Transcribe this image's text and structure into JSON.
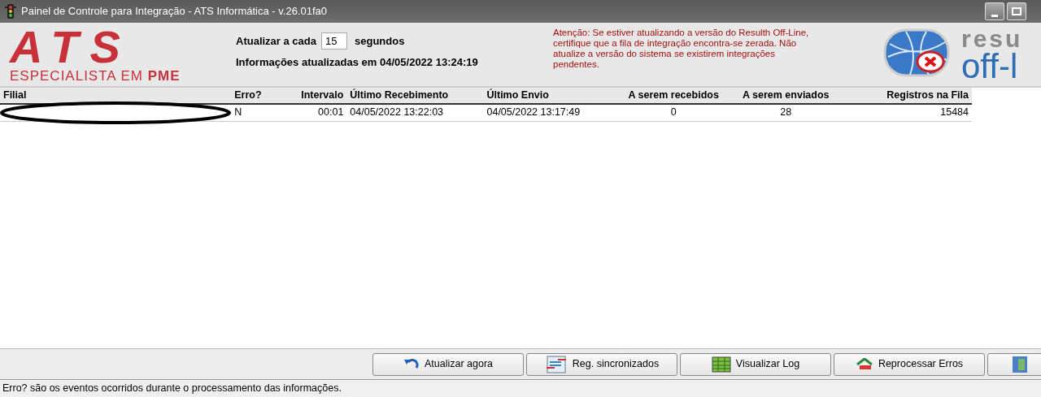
{
  "window": {
    "title": "Painel de Controle para Integração - ATS Informática - v.26.01fa0"
  },
  "logo": {
    "mark": "ATS",
    "tagline": "ESPECIALISTA EM ",
    "tagline_bold": "PME"
  },
  "refresh": {
    "label": "Atualizar a cada",
    "value": "15",
    "unit": "segundos",
    "updated": "Informações atualizadas em 04/05/2022 13:24:19"
  },
  "warning": "Atenção: Se estiver atualizando a versão do Resulth Off-Line, certifique que a fila de integração encontra-se zerada. Não atualize a versão do sistema se existirem integrações pendentes.",
  "brand": {
    "line1": "resu",
    "line2": "off-l"
  },
  "table": {
    "columns": [
      "Filial",
      "Erro?",
      "Intervalo",
      "Último Recebimento",
      "Último Envio",
      "A serem recebidos",
      "A serem enviados",
      "Registros na Fila"
    ],
    "rows": [
      {
        "cells": [
          null,
          "N",
          "00:01",
          "04/05/2022 13:22:03",
          "04/05/2022 13:17:49",
          "0",
          "28",
          "15484"
        ]
      }
    ]
  },
  "buttons": [
    {
      "kind": "refresh",
      "label": "Atualizar agora"
    },
    {
      "kind": "sync",
      "label": "Reg. sincronizados"
    },
    {
      "kind": "log",
      "label": "Visualizar Log"
    },
    {
      "kind": "reprocess",
      "label": "Reprocessar Erros"
    },
    {
      "kind": "exit"
    }
  ],
  "status_bar": "Erro? são os eventos ocorridos durante o processamento das informações."
}
